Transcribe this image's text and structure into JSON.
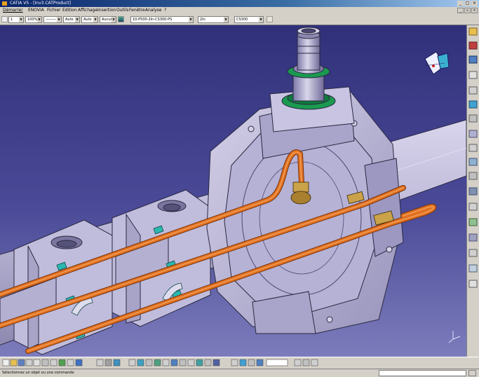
{
  "window": {
    "title": "CATIA V5 - [Inv3.CATProduct]"
  },
  "menu": {
    "items": [
      {
        "label": "Démarrer",
        "active": true
      },
      {
        "label": "ENOVIA"
      },
      {
        "label": "Fichier"
      },
      {
        "label": "Edition"
      },
      {
        "label": "Affichage"
      },
      {
        "label": "Insertion"
      },
      {
        "label": "Outils"
      },
      {
        "label": "Fenêtre"
      },
      {
        "label": "Analyse"
      },
      {
        "label": "?"
      }
    ]
  },
  "toolbar": {
    "combos": [
      {
        "value": "1"
      },
      {
        "value": "100%"
      },
      {
        "value": "———"
      },
      {
        "value": "Auto"
      },
      {
        "value": "Auto"
      },
      {
        "value": "Aucun"
      },
      {
        "value": "10-P500-2In-CS300-PS"
      },
      {
        "value": "2In"
      },
      {
        "value": "CS300"
      }
    ]
  },
  "statusbar": {
    "message": "Sélectionnez un objet ou une commande"
  },
  "colors": {
    "viewport_top": "#30307a",
    "viewport_bottom": "#7c7cbc",
    "part_fill": "#c8c4e0",
    "pipe_fill": "#e07020",
    "clip_fill": "#2ab8b0",
    "flange_green": "#1a9a50"
  },
  "icons": {
    "compass": "compass-icon",
    "axis_triad": "axis-triad-icon"
  }
}
